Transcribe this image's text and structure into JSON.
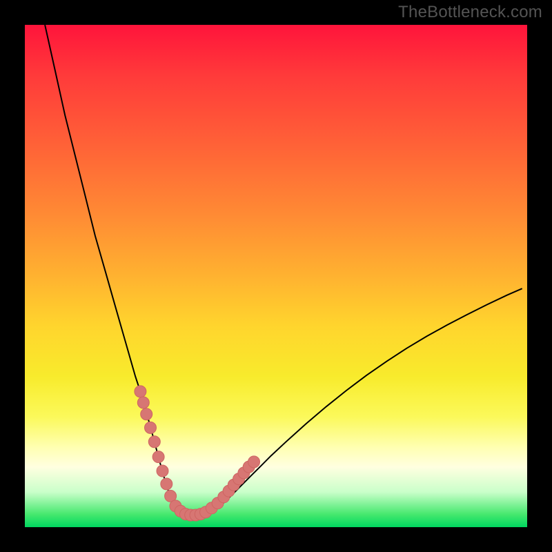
{
  "watermark": "TheBottleneck.com",
  "colors": {
    "frame": "#000000",
    "curve": "#000000",
    "marker": "#d77673",
    "gradient_top": "#ff143b",
    "gradient_bottom": "#00d760"
  },
  "chart_data": {
    "type": "line",
    "title": "",
    "xlabel": "",
    "ylabel": "",
    "xlim": [
      0,
      100
    ],
    "ylim": [
      0,
      100
    ],
    "curve": {
      "name": "bottleneck-curve",
      "x": [
        4,
        6,
        8,
        10,
        12,
        14,
        16,
        18,
        20,
        22,
        23,
        24,
        25,
        25.8,
        26.6,
        27.4,
        28,
        28.8,
        29.5,
        30.4,
        31.5,
        32.5,
        33.6,
        34.6,
        35.6,
        37,
        38.6,
        40,
        41.4,
        43,
        45,
        47,
        49,
        52,
        56,
        60,
        64,
        68,
        72,
        76,
        80,
        84,
        88,
        92,
        96,
        99
      ],
      "y": [
        100,
        91,
        82,
        74,
        66,
        58,
        51,
        44,
        37,
        30,
        27,
        23.5,
        20,
        17,
        14,
        11,
        9,
        6.5,
        5,
        3.8,
        3,
        2.6,
        2.4,
        2.4,
        2.6,
        3,
        4,
        5.2,
        6.6,
        8.2,
        10.2,
        12.2,
        14.2,
        17,
        20.6,
        24,
        27.2,
        30.2,
        33,
        35.6,
        38,
        40.2,
        42.3,
        44.3,
        46.2,
        47.5
      ]
    },
    "markers": {
      "name": "highlight-points",
      "x": [
        23.0,
        23.6,
        24.2,
        25.0,
        25.8,
        26.6,
        27.4,
        28.2,
        29.0,
        30.0,
        31.0,
        32.0,
        33.0,
        34.0,
        35.0,
        36.0,
        37.2,
        38.4,
        39.6,
        40.6,
        41.6,
        42.6,
        43.6,
        44.6,
        45.6
      ],
      "y": [
        27.0,
        24.8,
        22.5,
        19.8,
        17.0,
        14.0,
        11.2,
        8.6,
        6.2,
        4.2,
        3.2,
        2.6,
        2.4,
        2.4,
        2.6,
        3.0,
        3.8,
        4.8,
        6.0,
        7.2,
        8.4,
        9.6,
        10.8,
        12.0,
        13.0
      ]
    }
  }
}
